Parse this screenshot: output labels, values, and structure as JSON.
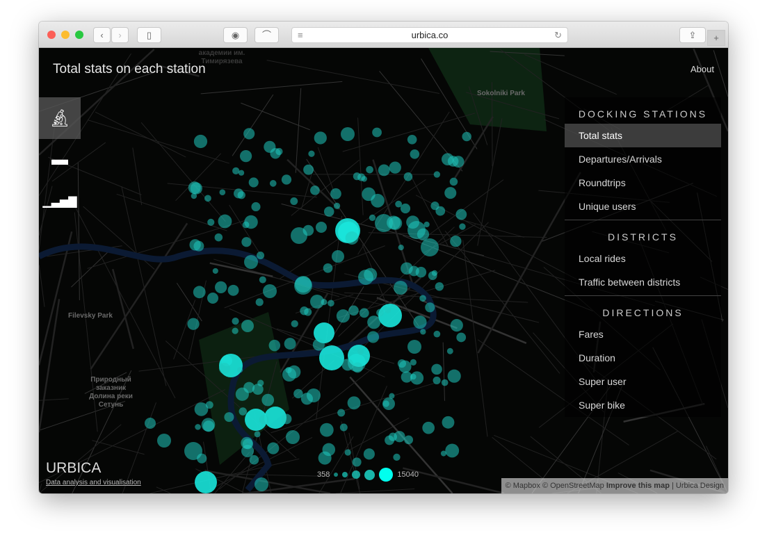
{
  "browser": {
    "url": "urbica.co"
  },
  "header": {
    "title": "Total stats on each station",
    "about": "About"
  },
  "left_icons": [
    "microscope-icon",
    "armchair-icon",
    "bar-chart-icon"
  ],
  "menu": {
    "sections": [
      {
        "title": "DOCKING STATIONS",
        "items": [
          "Total stats",
          "Departures/Arrivals",
          "Roundtrips",
          "Unique users"
        ]
      },
      {
        "title": "DISTRICTS",
        "items": [
          "Local rides",
          "Traffic between districts"
        ]
      },
      {
        "title": "DIRECTIONS",
        "items": [
          "Fares",
          "Duration",
          "Super user",
          "Super bike"
        ]
      }
    ],
    "active": "Total stats"
  },
  "map_labels": {
    "sokolniki": "Sokolniki Park",
    "filevsky": "Filevsky Park",
    "setun": "Природный заказник Долина реки Сетунь",
    "timiryazev": "академии им. Тимирязева"
  },
  "footer": {
    "logo": "URBICA",
    "tagline": "Data analysis and visualisation"
  },
  "legend": {
    "min": "358",
    "max": "15040"
  },
  "attribution": {
    "mapbox": "© Mapbox",
    "osm": "© OpenStreetMap",
    "improve": "Improve this map",
    "design": "Urbica Design"
  },
  "colors": {
    "station": "#1dd6c8",
    "station_max": "#00ffee",
    "background": "#050605"
  }
}
